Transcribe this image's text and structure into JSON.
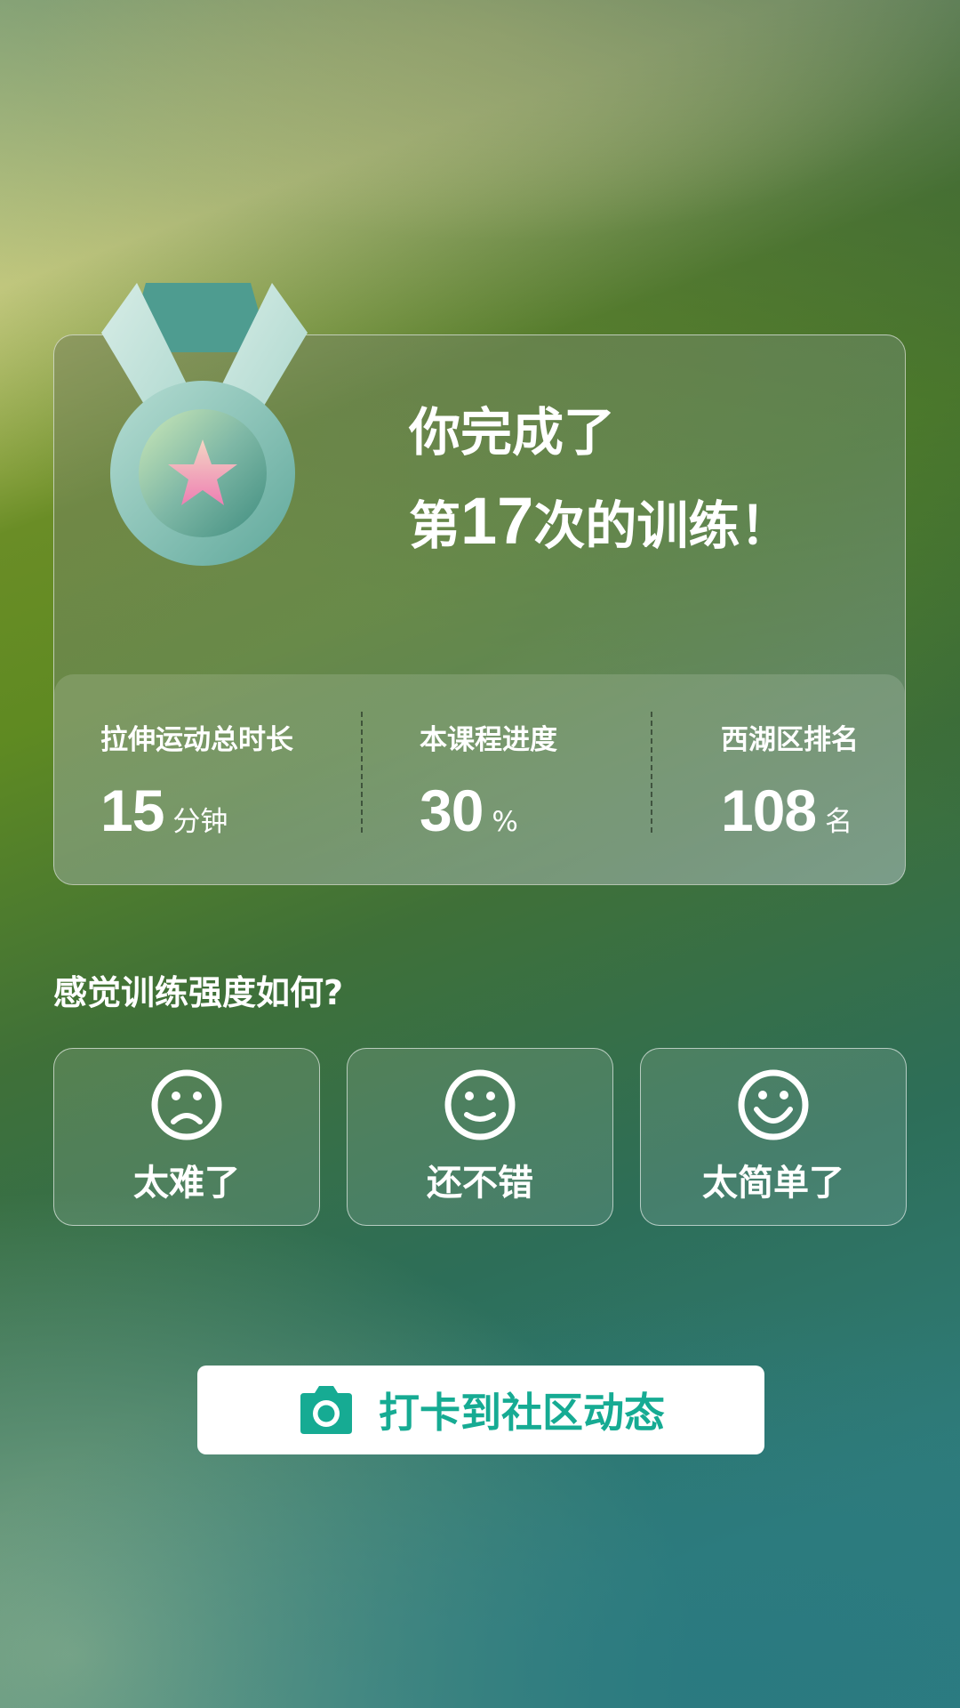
{
  "summary": {
    "line1": "你完成了",
    "line2_prefix": "第",
    "session_count": "17",
    "line2_suffix": "次的训练！"
  },
  "stats": [
    {
      "label": "拉伸运动总时长",
      "value": "15",
      "unit": "分钟"
    },
    {
      "label": "本课程进度",
      "value": "30",
      "unit": "%"
    },
    {
      "label": "西湖区排名",
      "value": "108",
      "unit": "名"
    }
  ],
  "feedback": {
    "question": "感觉训练强度如何?",
    "options": [
      {
        "label": "太难了",
        "icon": "frown-face-icon"
      },
      {
        "label": "还不错",
        "icon": "neutral-smile-face-icon"
      },
      {
        "label": "太简单了",
        "icon": "big-smile-face-icon"
      }
    ]
  },
  "checkin": {
    "label": "打卡到社区动态",
    "icon": "camera-icon",
    "color": "#16ab93"
  },
  "medal": {
    "icon": "medal-star-icon"
  }
}
